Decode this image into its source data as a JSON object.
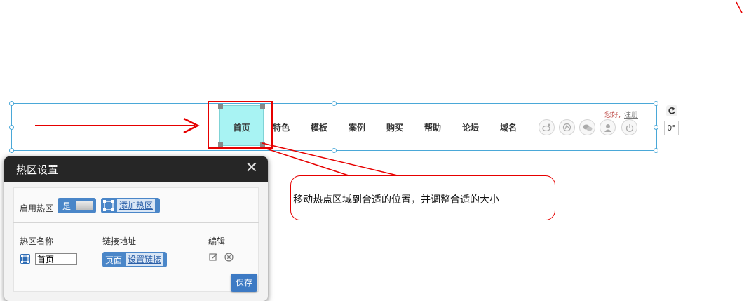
{
  "nav": {
    "items": [
      "首页",
      "特色",
      "模板",
      "案例",
      "购买",
      "帮助",
      "论坛",
      "域名"
    ],
    "hotspot_label": "首页"
  },
  "user": {
    "greeting": "您好,",
    "logout": "注册"
  },
  "editor": {
    "rotation": "0°"
  },
  "annotation": {
    "text": "移动热点区域到合适的位置，并调整合适的大小",
    "color": "#e60000"
  },
  "dialog": {
    "title": "热区设置",
    "enable_label": "启用热区",
    "toggle_value": "是",
    "add_hotspot": "添加热区",
    "columns": {
      "name": "热区名称",
      "link": "链接地址",
      "edit": "编辑"
    },
    "row": {
      "name_value": "首页",
      "link_type": "页面",
      "link_action": "设置链接"
    },
    "save": "保存"
  },
  "colors": {
    "accent": "#4a86c8",
    "hotspot": "#a8f3f3",
    "frame": "#4aa8d8",
    "header": "#262626"
  },
  "icons": [
    "weibo-icon",
    "qq-icon",
    "wechat-icon",
    "user-icon",
    "power-icon",
    "refresh-icon",
    "close-icon",
    "edit-icon",
    "delete-icon"
  ]
}
